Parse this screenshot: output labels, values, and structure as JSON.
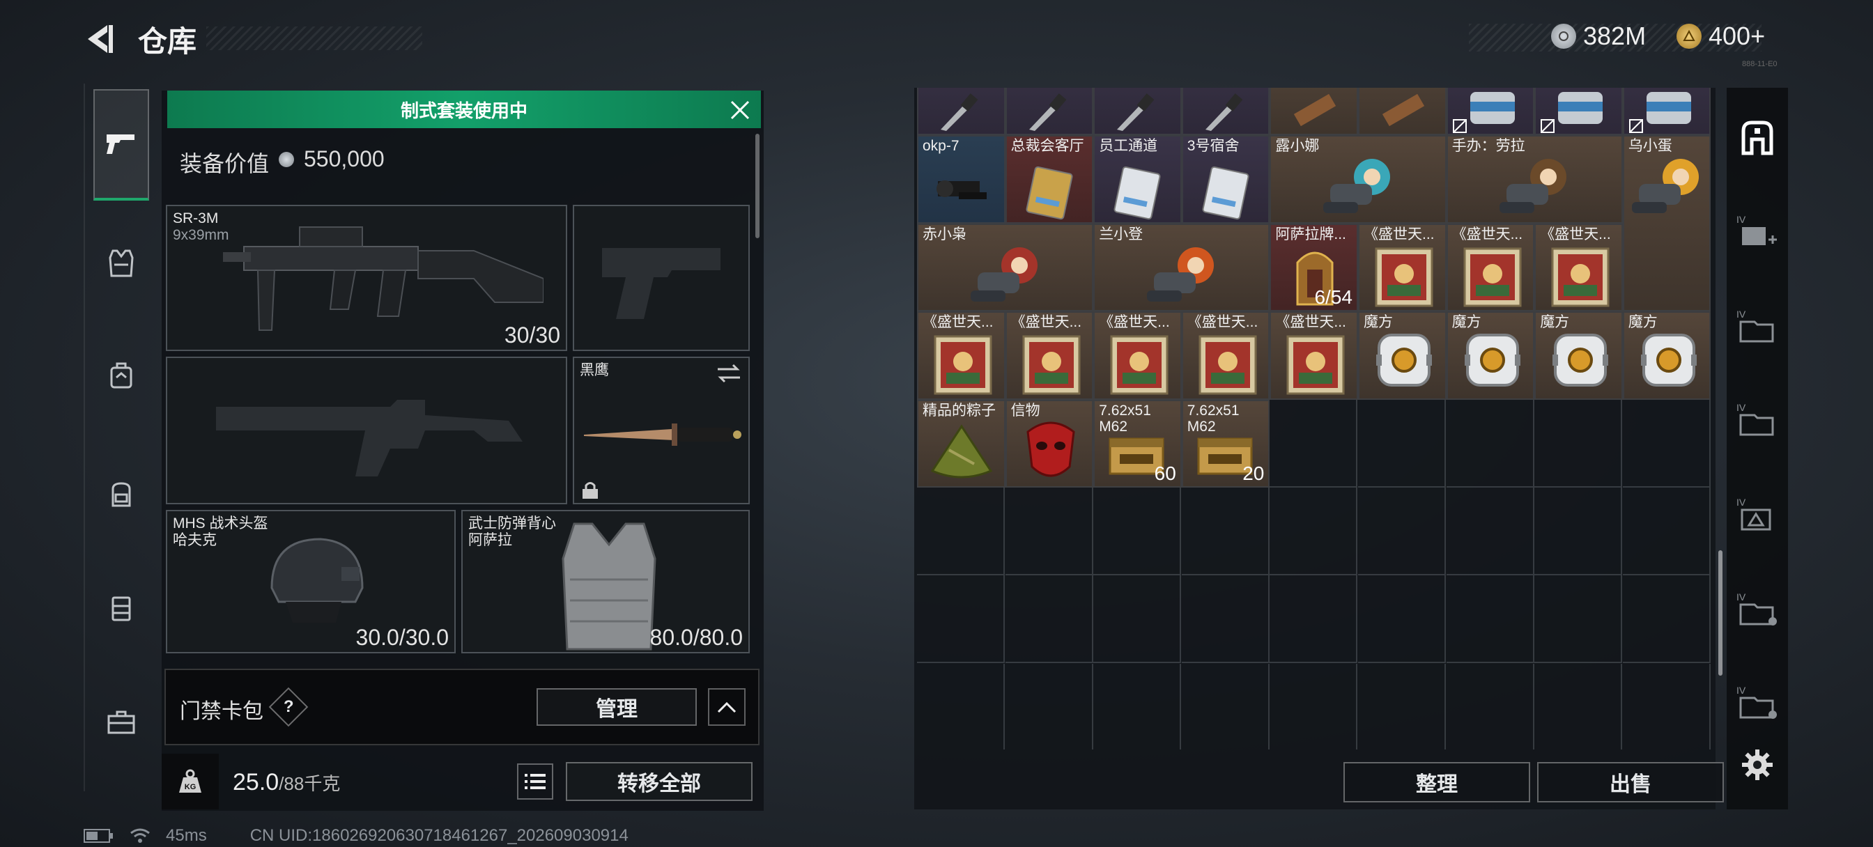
{
  "header": {
    "title": "仓库",
    "currency_coins": "382M",
    "currency_tickets": "400+",
    "tiny_code": "888-11-E0"
  },
  "rail": {
    "items": [
      "weapons",
      "armor",
      "chest-rig",
      "backpack",
      "container",
      "case"
    ]
  },
  "equipment": {
    "banner": "制式套装使用中",
    "value_label": "装备价值",
    "value": "550,000",
    "slots": {
      "primary": {
        "name": "SR-3M",
        "sub": "9x39mm",
        "count": "30/30"
      },
      "knife": {
        "name": "黑鹰"
      },
      "helmet": {
        "name": "MHS 战术头盔",
        "sub": "哈夫克",
        "count": "30.0/30.0"
      },
      "armor": {
        "name": "武士防弹背心",
        "sub": "阿萨拉",
        "count": "80.0/80.0"
      }
    },
    "card_bag_label": "门禁卡包",
    "help_glyph": "?",
    "manage_label": "管理",
    "weight_value": "25.0",
    "weight_unit": "/88千克",
    "transfer_label": "转移全部",
    "kg_label": "KG"
  },
  "warehouse": {
    "items": [
      {
        "name": "okp-7",
        "bg": "blue"
      },
      {
        "name": "总裁会客厅",
        "bg": "red"
      },
      {
        "name": "员工通道",
        "bg": "purple"
      },
      {
        "name": "3号宿舍",
        "bg": "purple"
      },
      {
        "name": "露小娜",
        "bg": "brown"
      },
      {
        "name": "手办：劳拉",
        "bg": "brown"
      },
      {
        "name": "乌小蛋",
        "bg": "brown"
      },
      {
        "name": "赤小枭",
        "bg": "brown"
      },
      {
        "name": "兰小登",
        "bg": "brown"
      },
      {
        "name": "阿萨拉牌...",
        "bg": "red",
        "count": "6/54"
      },
      {
        "name": "《盛世天...",
        "bg": "brown"
      },
      {
        "name": "《盛世天...",
        "bg": "brown"
      },
      {
        "name": "《盛世天...",
        "bg": "brown"
      },
      {
        "name": "《盛世天...",
        "bg": "brown"
      },
      {
        "name": "《盛世天...",
        "bg": "brown"
      },
      {
        "name": "《盛世天...",
        "bg": "brown"
      },
      {
        "name": "《盛世天...",
        "bg": "brown"
      },
      {
        "name": "《盛世天...",
        "bg": "brown"
      },
      {
        "name": "魔方",
        "bg": "brown"
      },
      {
        "name": "魔方",
        "bg": "brown"
      },
      {
        "name": "魔方",
        "bg": "brown"
      },
      {
        "name": "魔方",
        "bg": "brown"
      },
      {
        "name": "精品的粽子",
        "bg": "brown"
      },
      {
        "name": "信物",
        "bg": "brown"
      },
      {
        "name": "7.62x51 M62",
        "bg": "brown",
        "count": "60"
      },
      {
        "name": "7.62x51 M62",
        "bg": "brown",
        "count": "20"
      }
    ],
    "sort_label": "整理",
    "sell_label": "出售"
  },
  "storage_tabs": [
    "home",
    "add-expansion",
    "expansion-1",
    "expansion-2",
    "expansion-3",
    "expansion-4",
    "expansion-5"
  ],
  "status": {
    "ping": "45ms",
    "uid": "CN UID:18602692063071846126​7_202609030914"
  },
  "colors": {
    "accent_green": "#13a06a",
    "item_brown": "#4a3d33",
    "item_blue": "#263a4e",
    "item_red": "#4e2828"
  }
}
